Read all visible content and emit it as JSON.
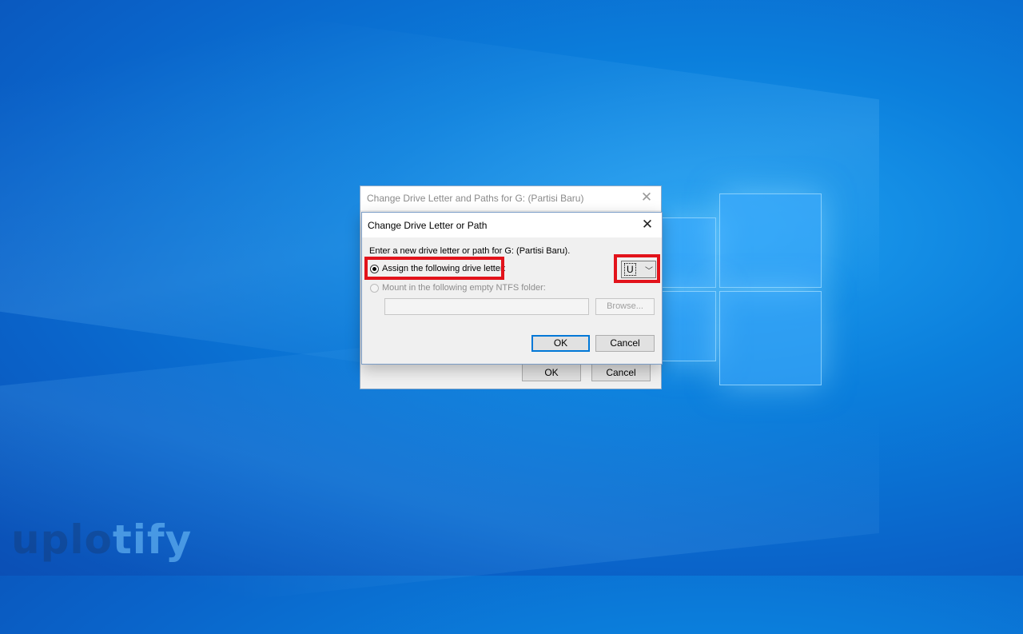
{
  "watermark": {
    "part1": "uplo",
    "part2": "tify"
  },
  "back_dialog": {
    "title": "Change Drive Letter and Paths for G: (Partisi Baru)",
    "close_icon": "close-icon",
    "ok_label": "OK",
    "cancel_label": "Cancel"
  },
  "front_dialog": {
    "title": "Change Drive Letter or Path",
    "close_icon": "close-icon",
    "prompt": "Enter a new drive letter or path for G: (Partisi Baru).",
    "assign_option": {
      "label": "Assign the following drive letter:",
      "selected": true
    },
    "drive_letter": {
      "value": "U",
      "icon": "chevron-down-icon"
    },
    "mount_option": {
      "label": "Mount in the following empty NTFS folder:",
      "selected": false,
      "enabled": false
    },
    "folder_path": {
      "value": ""
    },
    "browse_label": "Browse...",
    "ok_label": "OK",
    "cancel_label": "Cancel"
  },
  "colors": {
    "highlight": "#e2131b",
    "focus": "#0078d7",
    "desktop": "#0b7fdc"
  }
}
